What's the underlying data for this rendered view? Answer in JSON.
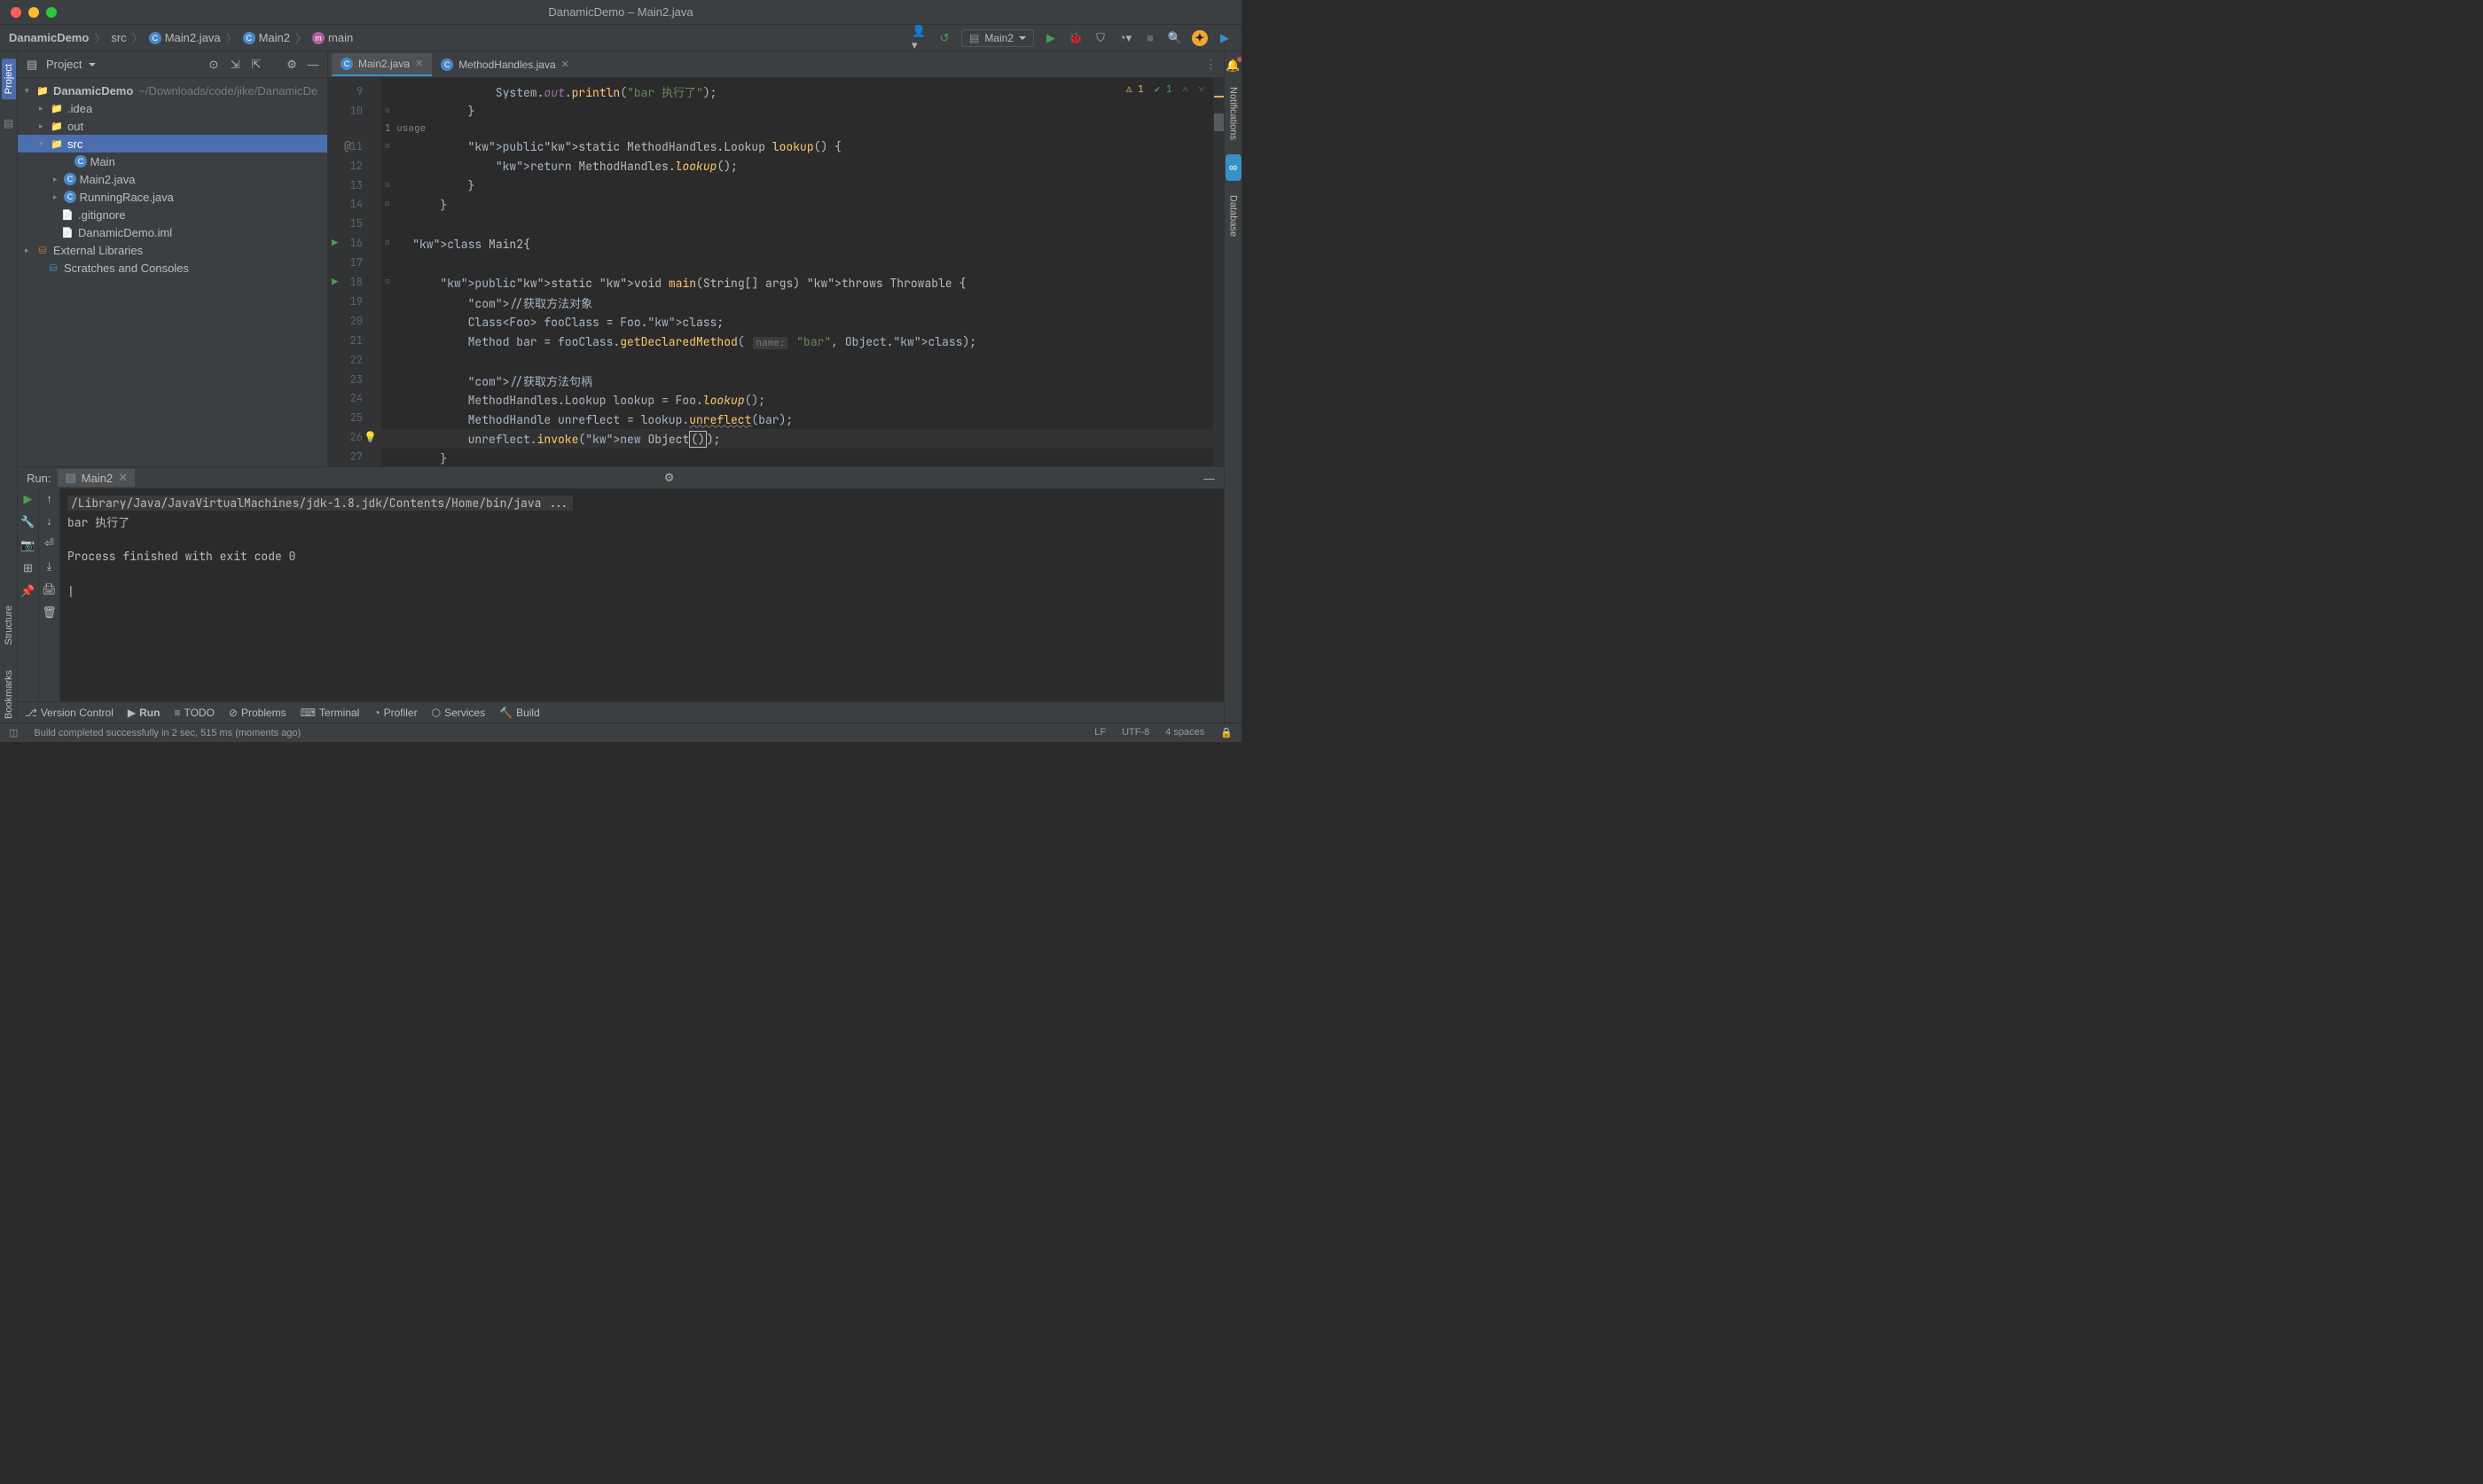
{
  "window": {
    "title": "DanamicDemo – Main2.java"
  },
  "breadcrumb": [
    "DanamicDemo",
    "src",
    "Main2.java",
    "Main2",
    "main"
  ],
  "runConfig": "Main2",
  "project": {
    "panel_title": "Project",
    "root": {
      "name": "DanamicDemo",
      "path": "~/Downloads/code/jike/DanamicDe"
    },
    "items": [
      {
        "name": ".idea"
      },
      {
        "name": "out"
      },
      {
        "name": "src",
        "expanded": true,
        "kids": [
          {
            "name": "Main"
          },
          {
            "name": "Main2.java"
          },
          {
            "name": "RunningRace.java"
          }
        ]
      },
      {
        "name": ".gitignore"
      },
      {
        "name": "DanamicDemo.iml"
      }
    ],
    "external": "External Libraries",
    "scratches": "Scratches and Consoles"
  },
  "editor": {
    "tabs": [
      {
        "name": "Main2.java",
        "active": true
      },
      {
        "name": "MethodHandles.java",
        "active": false
      }
    ],
    "inspection": {
      "warn": 1,
      "ok": 1
    },
    "gutterStart": 9,
    "lines": [
      {
        "n": 9,
        "t": "                System.out.println(\"bar 执行了\");"
      },
      {
        "n": 10,
        "t": "            }",
        "fold": true
      },
      {
        "n": "",
        "t": "            1 usage",
        "usage": true
      },
      {
        "n": 11,
        "t": "            public static MethodHandles.Lookup lookup() {",
        "at": true,
        "fold": true
      },
      {
        "n": 12,
        "t": "                return MethodHandles.lookup();"
      },
      {
        "n": 13,
        "t": "            }",
        "fold": true
      },
      {
        "n": 14,
        "t": "        }",
        "fold": true
      },
      {
        "n": 15,
        "t": ""
      },
      {
        "n": 16,
        "t": "    class Main2{",
        "run": true,
        "fold": true
      },
      {
        "n": 17,
        "t": ""
      },
      {
        "n": 18,
        "t": "        public static void main(String[] args) throws Throwable {",
        "run": true,
        "fold": true
      },
      {
        "n": 19,
        "t": "            //获取方法对象"
      },
      {
        "n": 20,
        "t": "            Class<Foo> fooClass = Foo.class;"
      },
      {
        "n": 21,
        "t": "            Method bar = fooClass.getDeclaredMethod( name: \"bar\", Object.class);"
      },
      {
        "n": 22,
        "t": ""
      },
      {
        "n": 23,
        "t": "            //获取方法句柄"
      },
      {
        "n": 24,
        "t": "            MethodHandles.Lookup lookup = Foo.lookup();"
      },
      {
        "n": 25,
        "t": "            MethodHandle unreflect = lookup.unreflect(bar);"
      },
      {
        "n": 26,
        "t": "            unreflect.invoke(new Object());",
        "hl": true,
        "bulb": true
      },
      {
        "n": 27,
        "t": "        }"
      }
    ]
  },
  "run": {
    "label": "Run:",
    "config": "Main2",
    "console": [
      "/Library/Java/JavaVirtualMachines/jdk-1.8.jdk/Contents/Home/bin/java ...",
      "bar 执行了",
      "",
      "Process finished with exit code 0",
      ""
    ]
  },
  "bottomTabs": [
    "Version Control",
    "Run",
    "TODO",
    "Problems",
    "Terminal",
    "Profiler",
    "Services",
    "Build"
  ],
  "leftGutter": {
    "project": "Project"
  },
  "rightGutter": {
    "notifications": "Notifications",
    "database": "Database"
  },
  "leftLower": [
    "Structure",
    "Bookmarks"
  ],
  "status": {
    "msg": "Build completed successfully in 2 sec, 515 ms (moments ago)",
    "lf": "LF",
    "enc": "UTF-8",
    "indent": "4 spaces"
  }
}
